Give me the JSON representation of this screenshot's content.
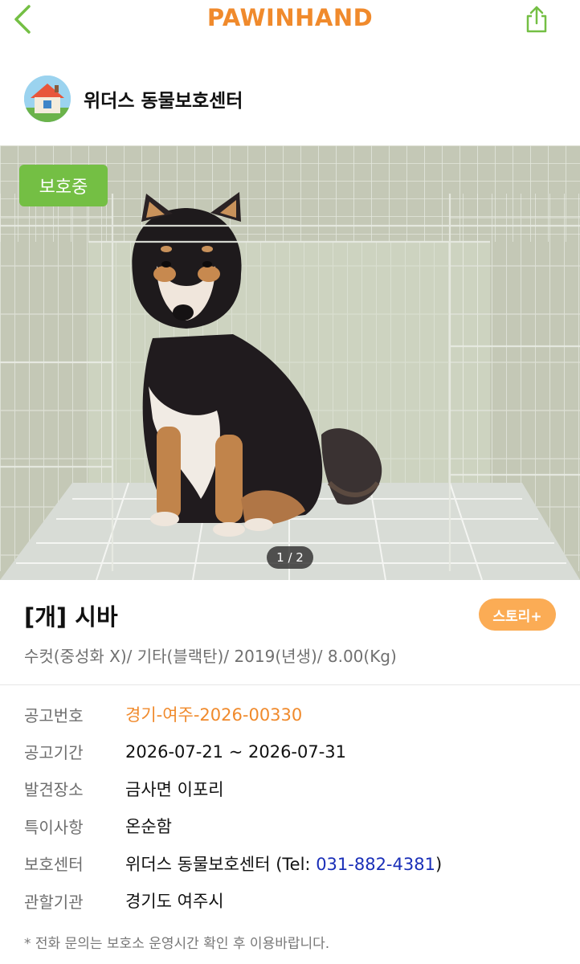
{
  "topbar": {
    "brand": "PAWINHAND",
    "back_icon": "chevron-left-icon",
    "share_icon": "share-icon",
    "accent_color": "#f08a2c",
    "icon_color": "#74bf44"
  },
  "shelter": {
    "name": "위더스 동물보호센터",
    "avatar_icon": "house-icon"
  },
  "photo": {
    "status_badge": "보호중",
    "status_color": "#74bf44",
    "page_indicator": "1 / 2"
  },
  "animal": {
    "title": "[개] 시바",
    "story_button": "스토리+",
    "story_color": "#fbac55",
    "summary": "수컷(중성화 X)/ 기타(블랙탄)/ 2019(년생)/ 8.00(Kg)"
  },
  "details": {
    "notice_no": {
      "label": "공고번호",
      "value": "경기-여주-2026-00330"
    },
    "notice_period": {
      "label": "공고기간",
      "value": "2026-07-21 ~ 2026-07-31"
    },
    "found_place": {
      "label": "발견장소",
      "value": "금사면 이포리"
    },
    "special_note": {
      "label": "특이사항",
      "value": "온순함"
    },
    "shelter_center": {
      "label": "보호센터",
      "value_prefix": "위더스 동물보호센터 (Tel: ",
      "phone": "031-882-4381",
      "value_suffix": ")"
    },
    "jurisdiction": {
      "label": "관할기관",
      "value": "경기도 여주시"
    }
  },
  "notice": "* 전화 문의는 보호소 운영시간 확인 후 이용바랍니다."
}
